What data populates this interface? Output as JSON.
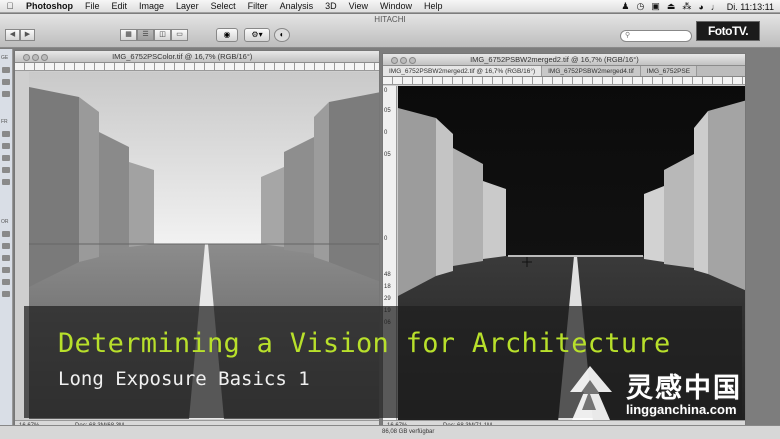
{
  "menubar": {
    "app_name": "Photoshop",
    "items": [
      "File",
      "Edit",
      "Image",
      "Layer",
      "Select",
      "Filter",
      "Analysis",
      "3D",
      "View",
      "Window",
      "Help"
    ],
    "clock": "Di. 11:13:11"
  },
  "finder": {
    "title": "HITACHI",
    "sidebar_labels": [
      "GE",
      "FR",
      "OR"
    ]
  },
  "brand_logo": "FotoTV.",
  "doc_left": {
    "title": "IMG_6752PSColor.tif @ 16,7% (RGB/16°)",
    "zoom": "16,67%",
    "doc_size": "Doc: 68,3M/68,3M"
  },
  "doc_right": {
    "title": "IMG_6752PSBW2merged2.tif @ 16,7% (RGB/16°)",
    "tabs": [
      "IMG_6752PSBW2merged2.tif @ 16,7% (RGB/16°)",
      "IMG_6752PSBW2merged4.tif",
      "IMG_6752PSE"
    ],
    "zoom": "16,67%",
    "doc_size": "Doc: 68,3M/71,1M",
    "ruler_marks": [
      "0",
      "05",
      "0",
      "05",
      "0",
      "48",
      "18",
      "29",
      "19",
      "06"
    ]
  },
  "bottom_status": "86,08 GB verfügbar",
  "overlay": {
    "title": "Determining a Vision for Architecture",
    "subtitle": "Long Exposure Basics 1"
  },
  "watermark": {
    "cn": "灵感中国",
    "url": "lingganchina.com"
  },
  "colors": {
    "title_green": "#b8e02b",
    "overlay_bg": "#1e1e1e"
  }
}
